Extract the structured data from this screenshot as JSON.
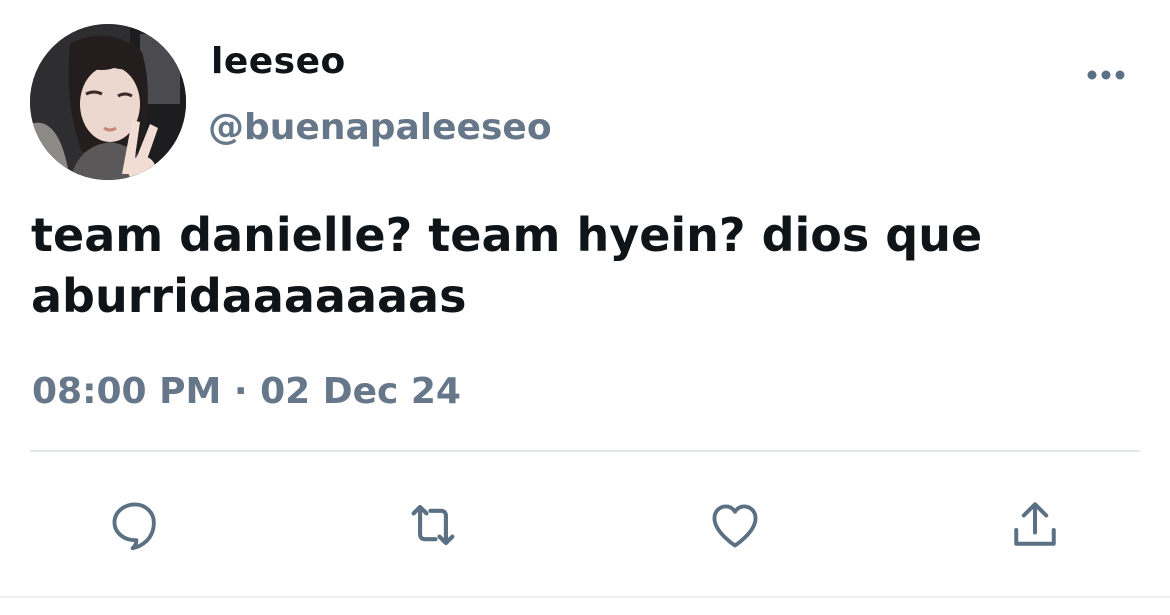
{
  "tweet": {
    "author": {
      "display_name": "leeseo",
      "handle": "@buenapaleeseo"
    },
    "text_lines": [
      "team danielle? team hyein? dios que",
      "aburridaaaaaaas"
    ],
    "time": "08:00 PM",
    "separator": "·",
    "date": "02 Dec 24",
    "timestamp": "08:00 PM · 02 Dec 24"
  },
  "actions": [
    {
      "icon": "reply-icon"
    },
    {
      "icon": "retweet-icon"
    },
    {
      "icon": "like-icon"
    },
    {
      "icon": "share-icon"
    }
  ],
  "colors": {
    "text": "#0f1419",
    "secondary": "#66778a",
    "icon": "#5b7083",
    "divider": "#e3e7ea",
    "background": "#ffffff"
  }
}
